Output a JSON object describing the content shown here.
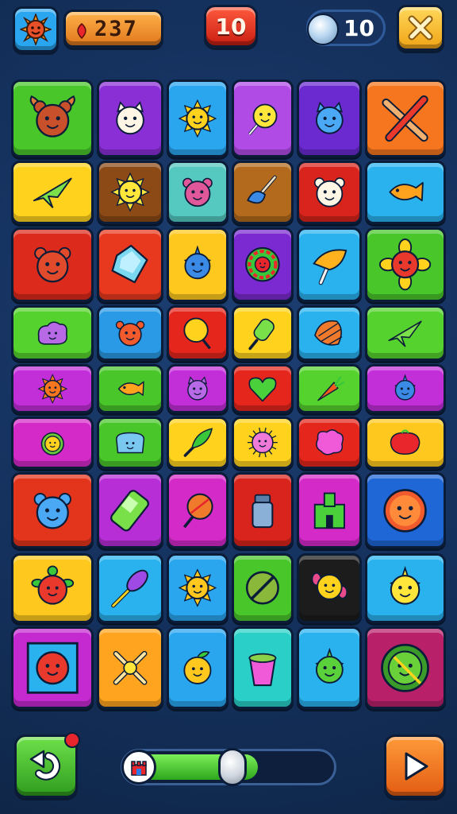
{
  "hud": {
    "coins": "237",
    "level": "10",
    "moves": "10",
    "avatar_icon": "sun-face-icon",
    "coin_icon": "red-gem-icon",
    "moves_icon": "crystal-orb-icon",
    "close_icon": "close-x-icon"
  },
  "board": {
    "rows": [
      [
        {
          "color": "#48c62a",
          "icon": "winged-creature-icon"
        },
        {
          "color": "#8a2ed6",
          "icon": "white-cat-icon"
        },
        {
          "color": "#2aa6ef",
          "icon": "sunflower-icon"
        },
        {
          "color": "#b14be6",
          "icon": "lollipop-face-icon"
        },
        {
          "color": "#6a2ad0",
          "icon": "blue-cat-icon"
        },
        {
          "color": "#f5761e",
          "icon": "crossed-sticks-icon"
        }
      ],
      [
        {
          "color": "#ffd21e",
          "icon": "green-star-icon"
        },
        {
          "color": "#8c4a16",
          "icon": "smiley-sun-icon"
        },
        {
          "color": "#55c8c0",
          "icon": "pink-bear-icon"
        },
        {
          "color": "#b36a1c",
          "icon": "plunger-icon"
        },
        {
          "color": "#d8241c",
          "icon": "white-dog-icon"
        },
        {
          "color": "#2ab2ef",
          "icon": "orange-fish-icon"
        }
      ],
      [
        {
          "color": "#dc2a1c",
          "icon": "red-bear-icon"
        },
        {
          "color": "#e8391e",
          "icon": "crystal-gem-icon"
        },
        {
          "color": "#ffc81e",
          "icon": "blue-fish-icon"
        },
        {
          "color": "#7a2ad0",
          "icon": "ring-donut-icon"
        },
        {
          "color": "#2ab2ef",
          "icon": "ice-cream-icon"
        },
        {
          "color": "#48c62a",
          "icon": "red-flower-icon"
        }
      ],
      [
        {
          "color": "#56d22e",
          "icon": "purple-blob-icon"
        },
        {
          "color": "#2a9ae6",
          "icon": "red-crab-icon"
        },
        {
          "color": "#e4261c",
          "icon": "yellow-lollipop-icon"
        },
        {
          "color": "#ffd21e",
          "icon": "popsicle-icon"
        },
        {
          "color": "#2ab2ef",
          "icon": "shell-icon"
        },
        {
          "color": "#56d22e",
          "icon": "green-star-icon"
        }
      ],
      [
        {
          "color": "#c22ed8",
          "icon": "sun-face-icon"
        },
        {
          "color": "#48c62a",
          "icon": "orange-fish-icon"
        },
        {
          "color": "#c22ed8",
          "icon": "purple-cat-icon"
        },
        {
          "color": "#e4261c",
          "icon": "green-heart-icon"
        },
        {
          "color": "#56d22e",
          "icon": "carrot-icon"
        },
        {
          "color": "#c22ed8",
          "icon": "blue-fish-icon"
        }
      ],
      [
        {
          "color": "#d42ac8",
          "icon": "turtle-icon"
        },
        {
          "color": "#48c62a",
          "icon": "blue-blob-icon"
        },
        {
          "color": "#ffd21e",
          "icon": "green-leaf-icon"
        },
        {
          "color": "#ffd21e",
          "icon": "pink-spiky-icon"
        },
        {
          "color": "#e4261c",
          "icon": "pink-splat-icon"
        },
        {
          "color": "#ffc81e",
          "icon": "tomato-icon"
        }
      ],
      [
        {
          "color": "#e3341c",
          "icon": "blue-bear-icon"
        },
        {
          "color": "#b82ed6",
          "icon": "battery-icon"
        },
        {
          "color": "#d42ac8",
          "icon": "orange-lollipop-icon"
        },
        {
          "color": "#d8241c",
          "icon": "jar-icon"
        },
        {
          "color": "#d42ac8",
          "icon": "green-castle-icon"
        },
        {
          "color": "#1f66d6",
          "icon": "orange-clown-icon"
        }
      ],
      [
        {
          "color": "#ffc81e",
          "icon": "red-turtle-icon"
        },
        {
          "color": "#2ab2ef",
          "icon": "purple-spoon-icon"
        },
        {
          "color": "#2aa6ef",
          "icon": "yellow-sun-icon"
        },
        {
          "color": "#48c62a",
          "icon": "no-sign-icon"
        },
        {
          "color": "#1c1c1c",
          "icon": "dark-bird-icon"
        },
        {
          "color": "#2ab2ef",
          "icon": "yellow-spiky-icon"
        }
      ],
      [
        {
          "color": "#c42ad0",
          "icon": "framed-face-icon"
        },
        {
          "color": "#ffa41e",
          "icon": "crossed-bones-icon"
        },
        {
          "color": "#2aa6ef",
          "icon": "orange-fruit-icon"
        },
        {
          "color": "#2ad0c8",
          "icon": "pink-cup-icon"
        },
        {
          "color": "#2ab2ef",
          "icon": "green-dragon-icon"
        },
        {
          "color": "#b8206a",
          "icon": "green-spiky-face-icon"
        }
      ]
    ]
  },
  "footer": {
    "undo_icon": "undo-arrow-icon",
    "play_icon": "play-triangle-icon",
    "progress": 0.63,
    "progress_icon": "castle-icon",
    "progress_knob": 0.52
  }
}
